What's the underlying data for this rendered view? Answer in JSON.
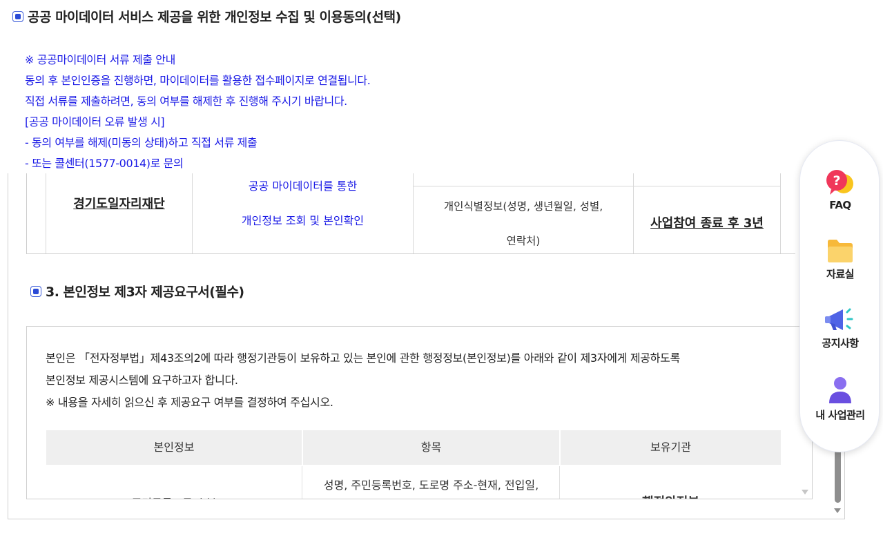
{
  "top_section": {
    "title": "공공 마이데이터 서비스 제공을 위한 개인정보 수집 및 이용동의(선택)"
  },
  "notice": {
    "lines": [
      "※ 공공마이데이터 서류 제출 안내",
      "동의 후 본인인증을 진행하면, 마이데이터를 활용한 접수페이지로 연결됩니다.",
      "직접 서류를 제출하려면, 동의 여부를 해제한 후 진행해 주시기 바랍니다.",
      "[공공 마이데이터 오류 발생 시]",
      "- 동의 여부를 해제(미동의 상태)하고 직접 서류 제출",
      "- 또는 콜센터(1577-0014)로 문의"
    ],
    "color": "#1a1ae6"
  },
  "consent_table": {
    "org": "경기도일자리재단",
    "purpose_lines": [
      "공공 마이데이터를 통한",
      "개인정보 조회 및 본인확인"
    ],
    "items_lines": [
      "개인식별정보(성명, 생년월일, 성별,",
      "연락처)"
    ],
    "period": "사업참여 종료 후 3년"
  },
  "section3": {
    "title": "3. 본인정보 제3자 제공요구서(필수)",
    "intro_lines": [
      "본인은 「전자정부법」제43조의2에 따라 행정기관등이 보유하고 있는 본인에 관한 행정정보(본인정보)를 아래와 같이 제3자에게 제공하도록",
      "본인정보 제공시스템에 요구하고자 합니다.",
      "※ 내용을 자세히 읽으신 후 제공요구 여부를 결정하여 주십시오."
    ],
    "table": {
      "headers": [
        "본인정보",
        "항목",
        "보유기관"
      ],
      "row1": {
        "info": "주민등록표등·초본",
        "items": "성명, 주민등록번호, 도로명 주소-현재, 전입일,",
        "agency": "행정안전부"
      }
    }
  },
  "quick_menu": {
    "items": [
      {
        "label": "FAQ",
        "icon": "faq-icon"
      },
      {
        "label": "자료실",
        "icon": "folder-icon"
      },
      {
        "label": "공지사항",
        "icon": "megaphone-icon"
      },
      {
        "label": "내 사업관리",
        "icon": "user-icon"
      }
    ]
  },
  "colors": {
    "accent_blue": "#2b4bd6",
    "notice_blue": "#1a1ae6"
  }
}
